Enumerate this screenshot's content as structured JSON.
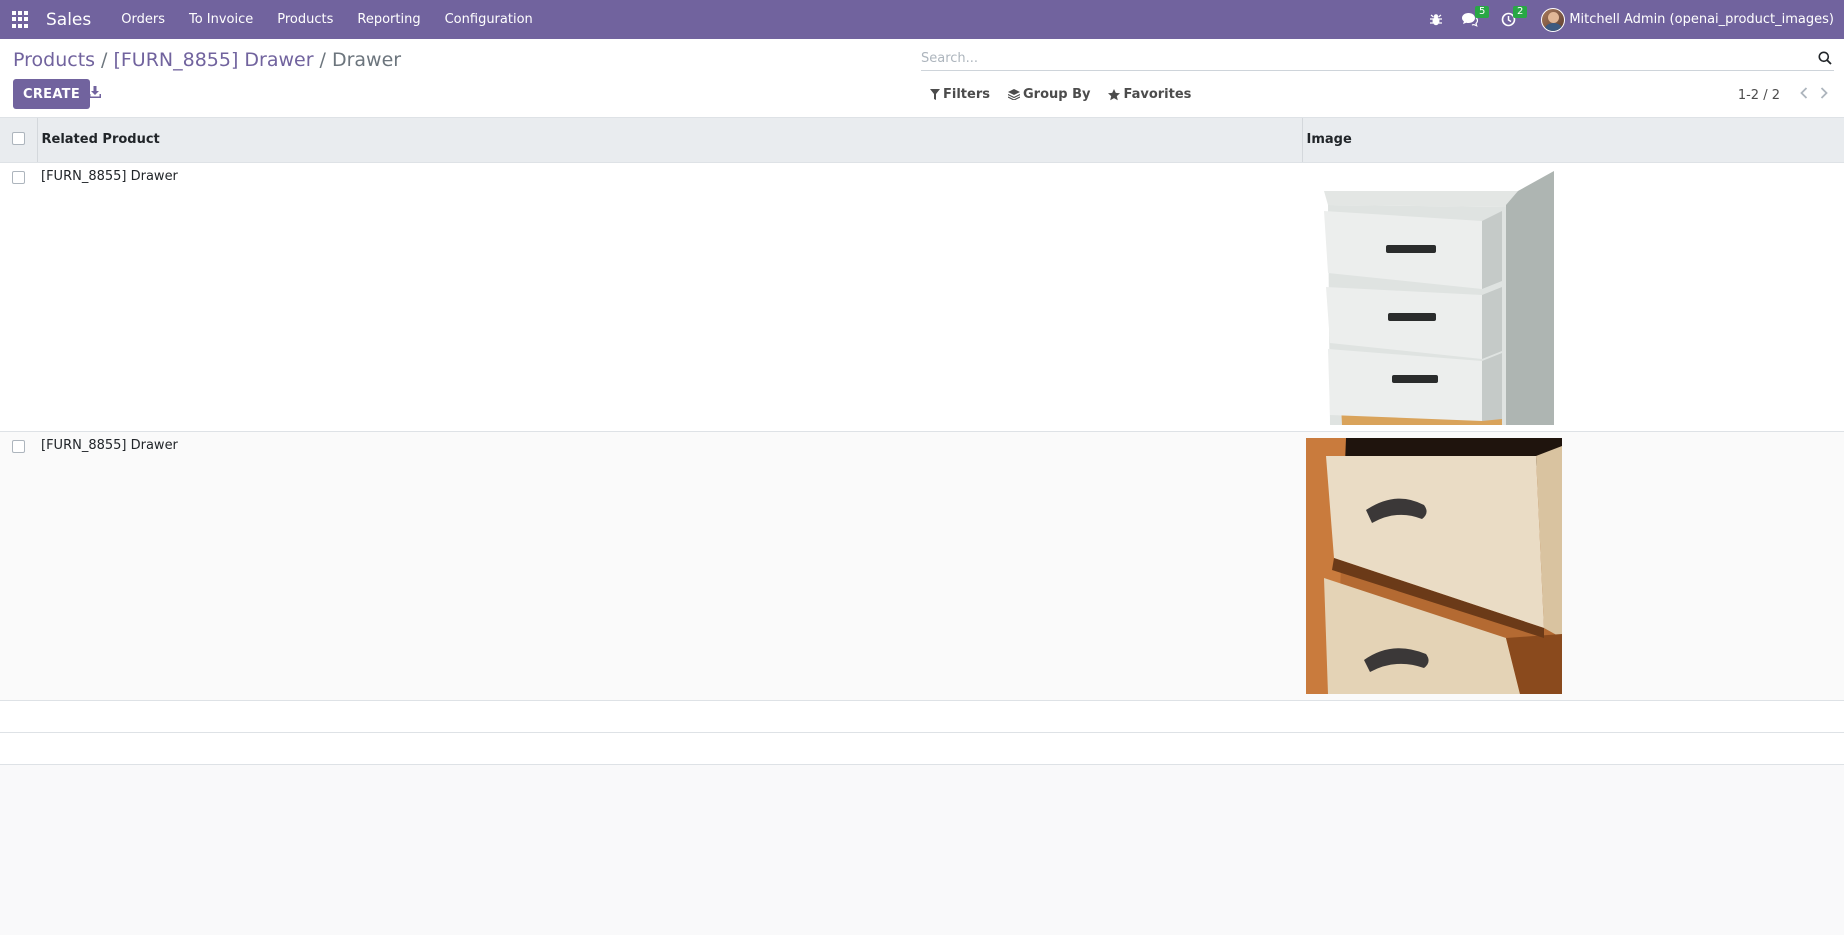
{
  "navbar": {
    "app_name": "Sales",
    "menu": [
      "Orders",
      "To Invoice",
      "Products",
      "Reporting",
      "Configuration"
    ],
    "messages_count": "5",
    "activities_count": "2",
    "user": "Mitchell Admin (openai_product_images)",
    "icons": [
      "apps-icon",
      "bug-icon",
      "chat-icon",
      "clock-icon",
      "avatar"
    ]
  },
  "breadcrumb": {
    "items": [
      "Products",
      "[FURN_8855] Drawer"
    ],
    "current": "Drawer"
  },
  "toolbar": {
    "create_label": "CREATE",
    "download_icon": "download-icon"
  },
  "search": {
    "placeholder": "Search...",
    "value": ""
  },
  "filters": {
    "filters_label": "Filters",
    "group_by_label": "Group By",
    "favorites_label": "Favorites"
  },
  "pager": {
    "value": "1-2 / 2"
  },
  "table": {
    "columns": [
      "Related Product",
      "Image"
    ],
    "rows": [
      {
        "related_product": "[FURN_8855] Drawer",
        "image": "white-drawer-cabinet"
      },
      {
        "related_product": "[FURN_8855] Drawer",
        "image": "wooden-drawers-closeup"
      }
    ]
  },
  "colors": {
    "brand": "#71639e",
    "badge": "#28a745",
    "header_bg": "#e9ecef"
  }
}
